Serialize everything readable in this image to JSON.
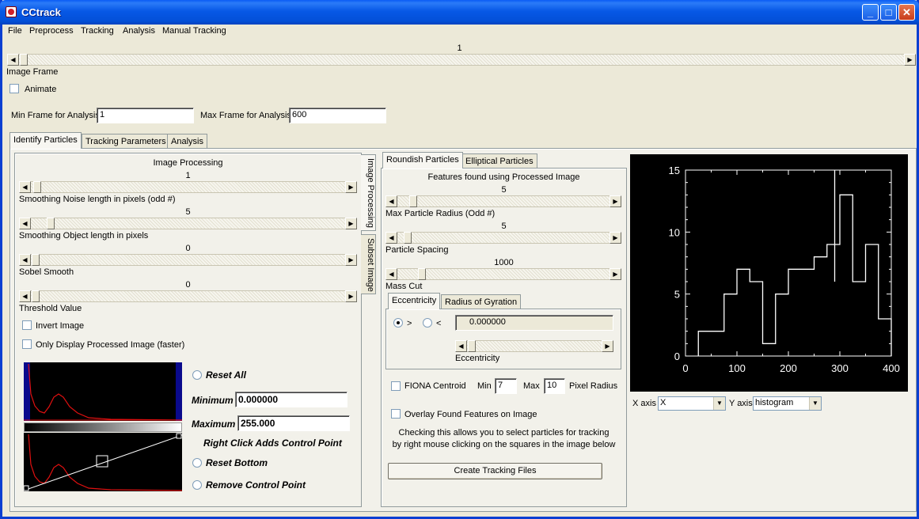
{
  "window": {
    "title": "CCtrack"
  },
  "menu": [
    "File",
    "Preprocess",
    "Tracking",
    "Analysis",
    "Manual Tracking"
  ],
  "frame": {
    "value": "1",
    "label": "Image Frame",
    "animate_label": "Animate"
  },
  "analysis_range": {
    "min_label": "Min Frame for Analysis",
    "min_value": "1",
    "max_label": "Max Frame for Analysis",
    "max_value": "600"
  },
  "main_tabs": [
    "Identify Particles",
    "Tracking Parameters",
    "Analysis"
  ],
  "side_tabs": [
    "Image Processing",
    "Subset Image"
  ],
  "image_processing": {
    "title": "Image Processing",
    "sliders": [
      {
        "value": "1",
        "label": "Smoothing Noise length in pixels (odd #)"
      },
      {
        "value": "5",
        "label": "Smoothing Object length in pixels"
      },
      {
        "value": "0",
        "label": "Sobel Smooth"
      },
      {
        "value": "0",
        "label": "Threshold Value"
      }
    ],
    "invert_label": "Invert Image",
    "only_processed_label": "Only Display Processed Image (faster)"
  },
  "colormap": {
    "reset_all": "Reset All",
    "minimum_label": "Minimum",
    "minimum_value": "0.000000",
    "maximum_label": "Maximum",
    "maximum_value": "255.000",
    "hint": "Right Click Adds Control Point",
    "reset_bottom": "Reset Bottom",
    "remove_point": "Remove Control Point"
  },
  "particle_tabs": [
    "Roundish Particles",
    "Elliptical Particles"
  ],
  "features": {
    "title": "Features found using Processed Image",
    "sliders": [
      {
        "value": "5",
        "label": "Max Particle Radius (Odd #)"
      },
      {
        "value": "5",
        "label": "Particle Spacing"
      },
      {
        "value": "1000",
        "label": "Mass Cut"
      }
    ],
    "sub_tabs": [
      "Eccentricity",
      "Radius of Gyration"
    ],
    "gt": ">",
    "lt": "<",
    "ecc_value": "0.000000",
    "ecc_label": "Eccentricity",
    "fiona_label": "FIONA Centroid",
    "min_label": "Min",
    "min_value": "7",
    "max_label": "Max",
    "max_value": "10",
    "pixel_radius_label": "Pixel Radius",
    "overlay_label": "Overlay Found Features on Image",
    "help1": "Checking this allows you to select particles for tracking",
    "help2": "by right mouse clicking on the squares in the image below",
    "create_button": "Create Tracking Files"
  },
  "plot_controls": {
    "xaxis_label": "X axis",
    "xaxis_value": "X",
    "yaxis_label": "Y axis",
    "yaxis_value": "histogram"
  },
  "chart_data": {
    "type": "line",
    "style": "step",
    "x": [
      25,
      50,
      75,
      100,
      125,
      150,
      175,
      200,
      225,
      250,
      275,
      300,
      325,
      350,
      375
    ],
    "y": [
      2,
      2,
      5,
      7,
      6,
      1,
      5,
      7,
      7,
      8,
      9,
      13,
      6,
      9,
      3
    ],
    "x_spike": {
      "x": 290,
      "y": 15
    },
    "xlim": [
      0,
      400
    ],
    "ylim": [
      0,
      15
    ],
    "xticks": [
      "0",
      "100",
      "200",
      "300",
      "400"
    ],
    "yticks": [
      "0",
      "5",
      "10",
      "15"
    ],
    "colors": {
      "background": "#000000",
      "line": "#FFFFFF"
    }
  }
}
